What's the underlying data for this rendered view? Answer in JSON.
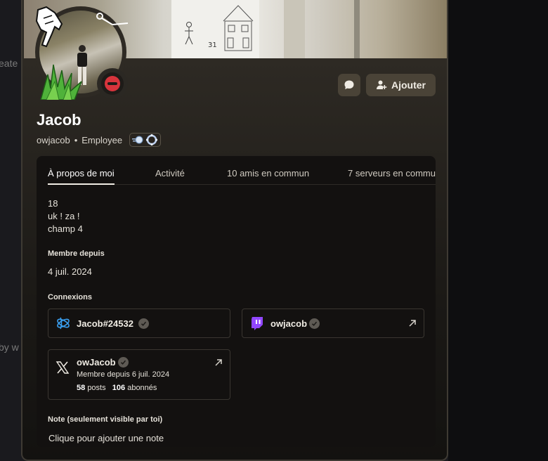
{
  "background": {
    "partial_text_1": "eate",
    "partial_text_2": "by w"
  },
  "banner": {
    "drawing_number": "31"
  },
  "profile": {
    "display_name": "Jacob",
    "username": "owjacob",
    "separator": "•",
    "role": "Employee",
    "status": "do-not-disturb",
    "status_color": "#d8343c"
  },
  "actions": {
    "message_icon": "message-bubble-icon",
    "add_label": "Ajouter",
    "add_icon": "add-friend-icon"
  },
  "tabs": [
    {
      "label": "À propos de moi",
      "active": true
    },
    {
      "label": "Activité",
      "active": false
    },
    {
      "label": "10 amis en commun",
      "active": false
    },
    {
      "label": "7 serveurs en commu",
      "active": false
    }
  ],
  "bio": {
    "line1": "18",
    "line2": "uk ! za !",
    "line3": "champ 4"
  },
  "member_since": {
    "title": "Membre depuis",
    "date": "4 juil. 2024"
  },
  "connections": {
    "title": "Connexions",
    "battlenet": {
      "name": "Jacob#24532",
      "icon": "battlenet-icon"
    },
    "twitch": {
      "name": "owjacob",
      "icon": "twitch-icon"
    },
    "x": {
      "name": "owJacob",
      "icon": "x-icon",
      "member_since": "Membre depuis 6 juil. 2024",
      "posts_count": "58",
      "posts_label": "posts",
      "followers_count": "106",
      "followers_label": "abonnés"
    }
  },
  "note": {
    "title": "Note (seulement visible par toi)",
    "placeholder": "Clique pour ajouter une note"
  }
}
